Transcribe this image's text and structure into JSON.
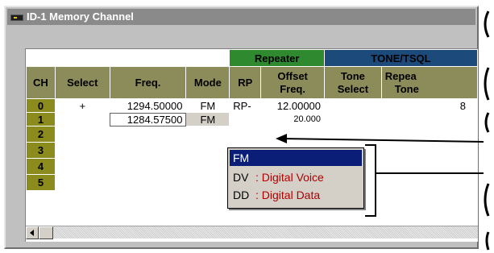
{
  "window": {
    "title": "ID-1 Memory Channel"
  },
  "groups": {
    "repeater": "Repeater",
    "tone_tsql": "TONE/TSQL"
  },
  "columns": {
    "ch": "CH",
    "select": "Select",
    "freq": "Freq.",
    "mode": "Mode",
    "rp": "RP",
    "offset_line1": "Offset",
    "offset_line2": "Freq.",
    "tone_line1": "Tone",
    "tone_line2": "Select",
    "repeater_tone_line1": "Repea",
    "repeater_tone_line2": "Tone"
  },
  "rows": [
    {
      "ch": "0",
      "select": "+",
      "freq": "1294.50000",
      "mode": "FM",
      "rp": "RP-",
      "offset": "12.00000",
      "tone": "",
      "rtone": "8"
    },
    {
      "ch": "1",
      "select": "",
      "freq": "1284.57500",
      "mode": "FM",
      "rp": "",
      "offset": "20.000",
      "tone": "",
      "rtone": ""
    },
    {
      "ch": "2",
      "select": "",
      "freq": "",
      "mode": "",
      "rp": "",
      "offset": "",
      "tone": "",
      "rtone": ""
    },
    {
      "ch": "3",
      "select": "",
      "freq": "",
      "mode": "",
      "rp": "",
      "offset": "",
      "tone": "",
      "rtone": ""
    },
    {
      "ch": "4",
      "select": "",
      "freq": "",
      "mode": "",
      "rp": "",
      "offset": "",
      "tone": "",
      "rtone": ""
    },
    {
      "ch": "5",
      "select": "",
      "freq": "",
      "mode": "",
      "rp": "",
      "offset": "",
      "tone": "",
      "rtone": ""
    }
  ],
  "mode_dropdown": {
    "options": [
      {
        "code": "FM",
        "desc": ""
      },
      {
        "code": "DV",
        "desc": ": Digital Voice"
      },
      {
        "code": "DD",
        "desc": ": Digital Data"
      }
    ],
    "selected": "FM"
  },
  "colors": {
    "header_olive": "#8c8c5a",
    "ch_olive": "#8c8c1e",
    "repeater_green": "#2f8a2f",
    "tone_navy": "#1c4a7a",
    "selection_navy": "#0a1e78",
    "desc_red": "#b00000"
  },
  "icons": {
    "app": "memory-channel-icon",
    "scroll_left": "left-arrow-icon",
    "callout": "bracket-icon"
  }
}
